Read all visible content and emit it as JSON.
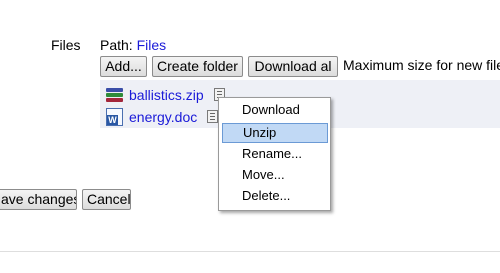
{
  "form": {
    "files_label": "Files",
    "path_label": "Path:",
    "path_link": "Files"
  },
  "toolbar": {
    "add_label": "Add...",
    "create_folder_label": "Create folder",
    "download_all_label": "Download al",
    "max_size_text": "Maximum size for new file"
  },
  "files": [
    {
      "name": "ballistics.zip",
      "type": "zip"
    },
    {
      "name": "energy.doc",
      "type": "doc"
    }
  ],
  "context_menu": {
    "items": [
      "Download",
      "Unzip",
      "Rename...",
      "Move...",
      "Delete..."
    ],
    "active": "Unzip"
  },
  "actions": {
    "save_label": "ave changes",
    "cancel_label": "Cancel"
  },
  "colors": {
    "link": "#1a1ad8",
    "filearea_bg": "#eef0f6",
    "menu_highlight": "#c1d9f5"
  }
}
